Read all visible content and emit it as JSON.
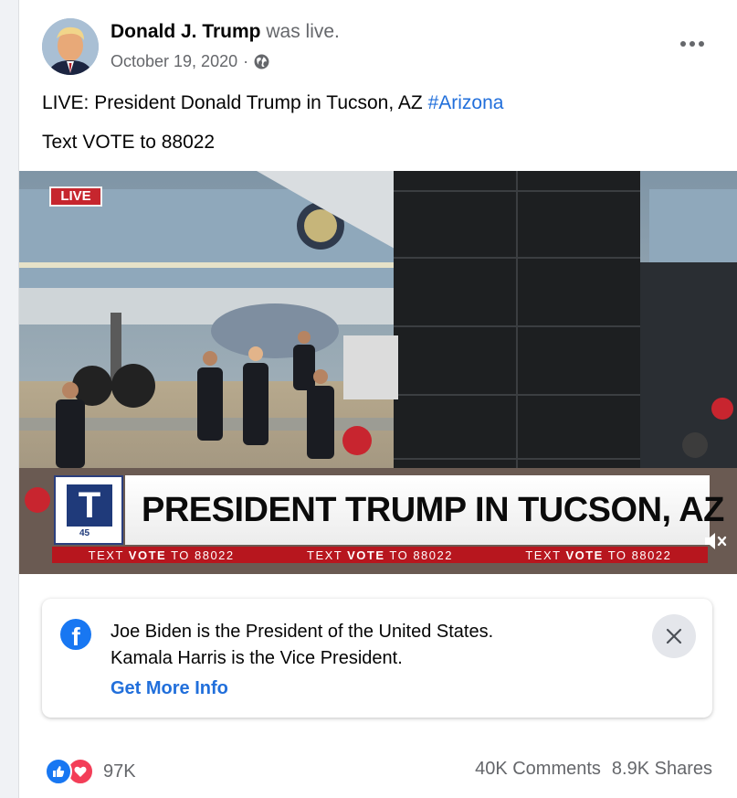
{
  "post": {
    "author": "Donald J. Trump",
    "action": "was live.",
    "date": "October 19, 2020",
    "separator": "·",
    "privacy_icon": "globe-icon",
    "more_icon": "more-horizontal-icon",
    "text_prefix": "LIVE: President Donald Trump in Tucson, AZ",
    "hashtag": "#Arizona",
    "text_line2": "Text VOTE to 88022"
  },
  "video": {
    "live_badge": "LIVE",
    "logo_letter": "T",
    "logo_number": "45",
    "headline": "PRESIDENT TRUMP IN TUCSON, AZ",
    "ticker": [
      {
        "prefix": "TEXT ",
        "keyword": "VOTE",
        "suffix": " TO 88022"
      },
      {
        "prefix": "TEXT ",
        "keyword": "VOTE",
        "suffix": " TO 88022"
      },
      {
        "prefix": "TEXT ",
        "keyword": "VOTE",
        "suffix": " TO 88022"
      }
    ],
    "mute_icon": "volume-muted-icon"
  },
  "info_box": {
    "icon": "facebook-icon",
    "line1": "Joe Biden is the President of the United States.",
    "line2": "Kamala Harris is the Vice President.",
    "link": "Get More Info",
    "close_icon": "close-icon"
  },
  "engagement": {
    "reactions": [
      "like-icon",
      "love-icon"
    ],
    "reaction_count": "97K",
    "comments": "40K Comments",
    "shares": "8.9K Shares"
  },
  "colors": {
    "link_blue": "#216fdb",
    "fb_blue": "#1877f2",
    "live_red": "#c6262e",
    "ticker_red": "#b7161e",
    "love_red": "#f33e58",
    "secondary_text": "#65676b"
  }
}
